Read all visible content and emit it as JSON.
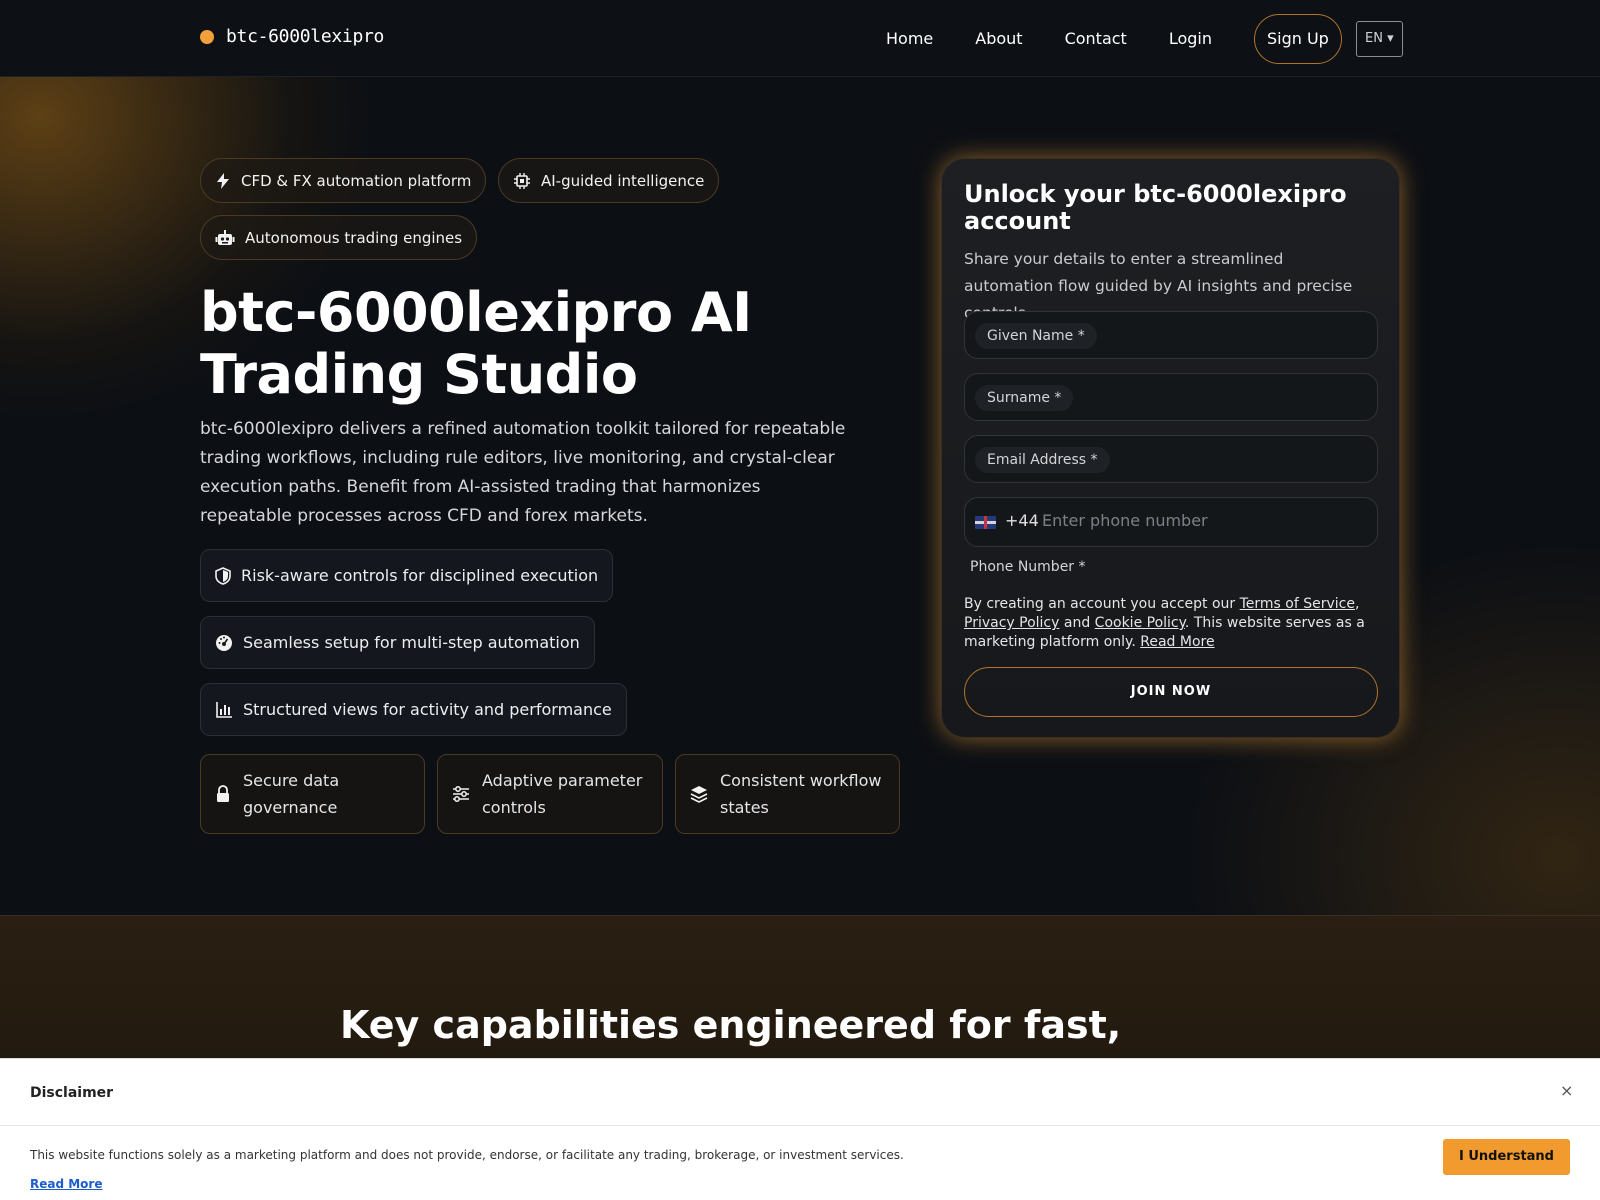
{
  "brand": {
    "name": "btc-6000lexipro",
    "accent": "#f2a13a"
  },
  "nav": {
    "items": [
      "Home",
      "About",
      "Contact",
      "Login"
    ],
    "signup": "Sign Up",
    "lang": "EN ▾"
  },
  "hero": {
    "pills": [
      "CFD & FX automation platform",
      "AI-guided intelligence",
      "Autonomous trading engines"
    ],
    "title": "btc-6000lexipro AI Trading Studio",
    "description": "btc-6000lexipro delivers a refined automation toolkit tailored for repeatable trading workflows, including rule editors, live monitoring, and crystal-clear execution paths. Benefit from AI-assisted trading that harmonizes repeatable processes across CFD and forex markets.",
    "features": [
      "Risk-aware controls for disciplined execution",
      "Seamless setup for multi-step automation",
      "Structured views for activity and performance"
    ],
    "cards": [
      "Secure data governance",
      "Adaptive parameter controls",
      "Consistent workflow states"
    ]
  },
  "form": {
    "title": "Unlock your btc-6000lexipro account",
    "subtitle": "Share your details to enter a streamlined automation flow guided by AI insights and precise controls.",
    "fields": {
      "given": "Given Name *",
      "surname": "Surname *",
      "email": "Email Address *"
    },
    "phone": {
      "code": "+44",
      "placeholder": "Enter phone number",
      "label": "Phone Number *"
    },
    "terms": {
      "pre": "By creating an account you accept our ",
      "tos": "Terms of Service",
      "sep1": ", ",
      "privacy": "Privacy Policy",
      "and": " and ",
      "cookie": "Cookie Policy",
      "post": ". This website serves as a marketing platform only. ",
      "read": "Read More"
    },
    "submit": "JOIN NOW"
  },
  "section2": {
    "title": "Key capabilities engineered for fast, reliable and seamless"
  },
  "disclaimer": {
    "title": "Disclaimer",
    "close": "×",
    "text": "This website functions solely as a marketing platform and does not provide, endorse, or facilitate any trading, brokerage, or investment services.",
    "read": "Read More",
    "button": "I Understand"
  }
}
